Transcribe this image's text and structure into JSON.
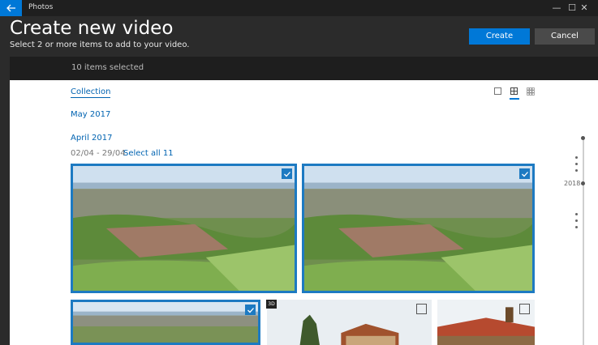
{
  "titlebar": {
    "app_title": "Photos",
    "back_icon": "arrow-left-icon",
    "minimize_glyph": "—",
    "maximize_glyph": "☐",
    "close_glyph": "✕"
  },
  "header": {
    "title": "Create new video",
    "subtitle": "Select 2 or more items to add to your video.",
    "create_label": "Create",
    "cancel_label": "Cancel"
  },
  "selection": {
    "count_text": "10 items selected"
  },
  "content": {
    "collection_label": "Collection",
    "month_may": "May 2017",
    "month_april": "April 2017",
    "date_range": "02/04 - 29/04",
    "select_all": "Select all 11"
  },
  "timeline": {
    "year": "2018"
  },
  "photos": [
    {
      "selected": true,
      "kind": "aerial"
    },
    {
      "selected": true,
      "kind": "aerial"
    },
    {
      "selected": true,
      "kind": "aerial"
    },
    {
      "selected": false,
      "kind": "house"
    },
    {
      "selected": false,
      "kind": "pergola"
    }
  ],
  "badge": {
    "label": "3D"
  },
  "colors": {
    "accent": "#0078d7",
    "link": "#0063b1",
    "header_bg": "#2b2b2b"
  }
}
